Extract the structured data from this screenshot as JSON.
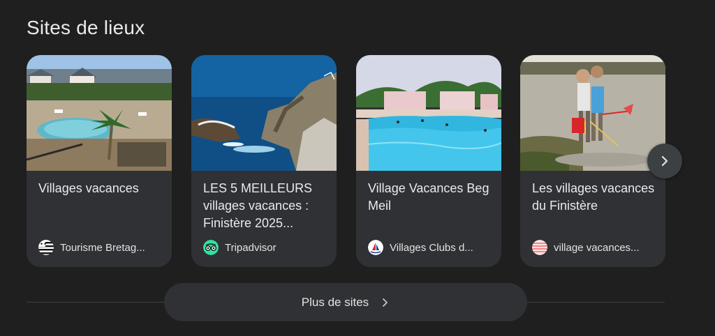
{
  "section": {
    "title": "Sites de lieux"
  },
  "cards": [
    {
      "title": "Villages vacances",
      "source": "Tourisme Bretag...",
      "favicon": "brittany-flag-icon"
    },
    {
      "title": "LES 5 MEILLEURS villages vacances : Finistère 2025...",
      "source": "Tripadvisor",
      "favicon": "tripadvisor-owl-icon"
    },
    {
      "title": "Village Vacances Beg Meil",
      "source": "Villages Clubs d...",
      "favicon": "villages-clubs-sail-icon"
    },
    {
      "title": "Les villages vacances du Finistère",
      "source": "village vacances...",
      "favicon": "striped-circle-icon"
    }
  ],
  "next_button": {
    "icon": "chevron-right-icon"
  },
  "more_button": {
    "label": "Plus de sites",
    "icon": "chevron-right-icon"
  },
  "colors": {
    "background": "#1f1f1f",
    "card": "#303134",
    "text": "#e8eaed"
  }
}
